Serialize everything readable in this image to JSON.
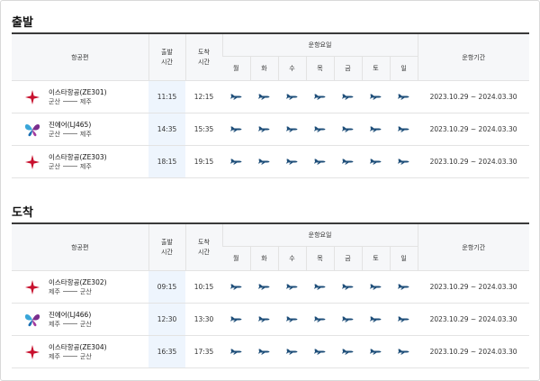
{
  "departure": {
    "title": "출발",
    "headers": {
      "flight": "항공편",
      "dep_time": "출발\n시간",
      "arr_time": "도착\n시간",
      "days_group": "운항요일",
      "period": "운항기간"
    },
    "days": [
      "월",
      "화",
      "수",
      "목",
      "금",
      "토",
      "일"
    ],
    "rows": [
      {
        "airline": "이스타항공(ZE301)",
        "from": "군산",
        "to": "제주",
        "dep": "11:15",
        "arr": "12:15",
        "period": "2023.10.29 ~ 2024.03.30",
        "logo": "eastar-star-icon"
      },
      {
        "airline": "진에어(LJ465)",
        "from": "군산",
        "to": "제주",
        "dep": "14:35",
        "arr": "15:35",
        "period": "2023.10.29 ~ 2024.03.30",
        "logo": "jinair-butterfly-icon"
      },
      {
        "airline": "이스타항공(ZE303)",
        "from": "군산",
        "to": "제주",
        "dep": "18:15",
        "arr": "19:15",
        "period": "2023.10.29 ~ 2024.03.30",
        "logo": "eastar-star-icon"
      }
    ]
  },
  "arrival": {
    "title": "도착",
    "headers": {
      "flight": "항공편",
      "dep_time": "출발\n시간",
      "arr_time": "도착\n시간",
      "days_group": "운항요일",
      "period": "운항기간"
    },
    "days": [
      "월",
      "화",
      "수",
      "목",
      "금",
      "토",
      "일"
    ],
    "rows": [
      {
        "airline": "이스타항공(ZE302)",
        "from": "제주",
        "to": "군산",
        "dep": "09:15",
        "arr": "10:15",
        "period": "2023.10.29 ~ 2024.03.30",
        "logo": "eastar-star-icon"
      },
      {
        "airline": "진에어(LJ466)",
        "from": "제주",
        "to": "군산",
        "dep": "12:30",
        "arr": "13:30",
        "period": "2023.10.29 ~ 2024.03.30",
        "logo": "jinair-butterfly-icon"
      },
      {
        "airline": "이스타항공(ZE304)",
        "from": "제주",
        "to": "군산",
        "dep": "16:35",
        "arr": "17:35",
        "period": "2023.10.29 ~ 2024.03.30",
        "logo": "eastar-star-icon"
      }
    ]
  },
  "colors": {
    "plane": "#1f4f7a",
    "eastar": "#c8102e",
    "dep_highlight": "#eef5fd"
  }
}
